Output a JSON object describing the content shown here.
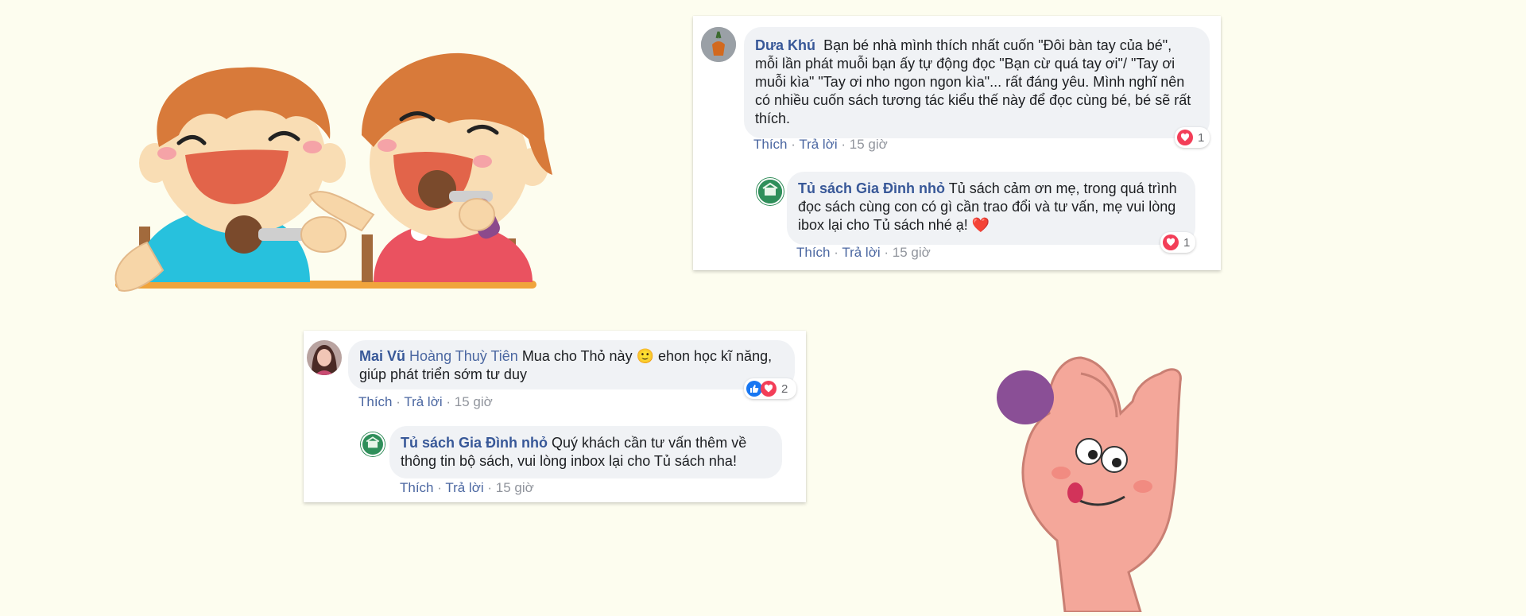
{
  "colors": {
    "background": "#fdfdef",
    "author_link": "#385898",
    "action_link": "#4b67a1",
    "love": "#f33e58",
    "like": "#1877f2"
  },
  "comments": [
    {
      "author": "Dưa Khú",
      "text": "Bạn bé nhà mình thích nhất cuốn \"Đôi bàn tay của bé\", mỗi lần phát muỗi bạn ấy tự động đọc \"Bạn cừ quá tay ơi\"/ \"Tay ơi muỗi kìa\" \"Tay ơi nho ngon ngon kìa\"... rất đáng yêu. Mình nghĩ nên có nhiều cuốn sách tương tác kiểu thế này để đọc cùng bé, bé sẽ rất thích.",
      "like_label": "Thích",
      "reply_label": "Trả lời",
      "time": "15 giờ",
      "reaction_icons": [
        "love-icon"
      ],
      "reaction_count": "1",
      "reply": {
        "author": "Tủ sách Gia Đình nhỏ",
        "text": "Tủ sách cảm ơn mẹ, trong quá trình đọc sách cùng con có gì cần trao đổi và tư vấn, mẹ vui lòng ibox lại cho Tủ sách nhé ạ! ❤️",
        "like_label": "Thích",
        "reply_label": "Trả lời",
        "time": "15 giờ",
        "reaction_icons": [
          "love-icon"
        ],
        "reaction_count": "1"
      }
    },
    {
      "author": "Mai Vũ",
      "tagged": "Hoàng Thuỳ Tiên",
      "text": "Mua cho Thỏ này 🙂 ehon học kĩ năng, giúp phát triển sớm tư duy",
      "like_label": "Thích",
      "reply_label": "Trả lời",
      "time": "15 giờ",
      "reaction_icons": [
        "like-icon",
        "love-icon"
      ],
      "reaction_count": "2",
      "reply": {
        "author": "Tủ sách Gia Đình nhỏ",
        "text": "Quý khách cần tư vấn thêm về thông tin bộ sách, vui lòng inbox lại cho Tủ sách nha!",
        "like_label": "Thích",
        "reply_label": "Trả lời",
        "time": "15 giờ"
      }
    }
  ],
  "illustrations": [
    "two-kids-eating-illustration",
    "hand-holding-grape-illustration"
  ]
}
